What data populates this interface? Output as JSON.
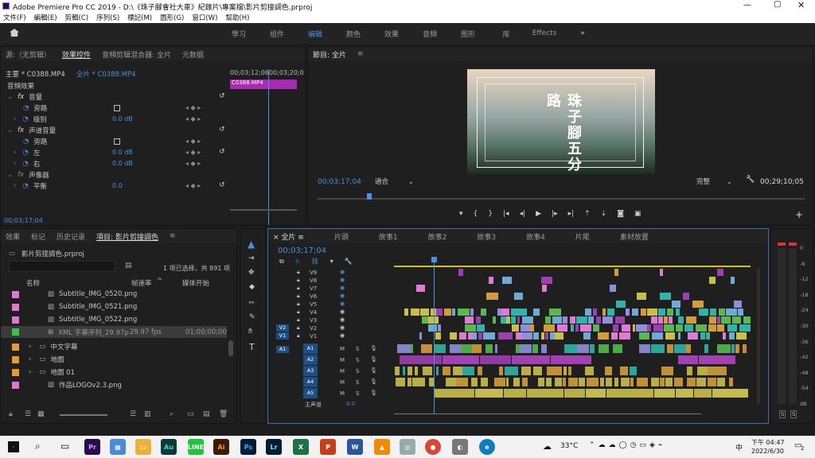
{
  "window": {
    "title": "Adobe Premiere Pro CC 2019 - D:\\《珠子腳會社大車》紀錄片\\專案檔\\影片剪接調色.prproj"
  },
  "menu": [
    "文件(F)",
    "編輯(E)",
    "剪輯(C)",
    "序列(S)",
    "標記(M)",
    "圖形(G)",
    "窗口(W)",
    "幫助(H)"
  ],
  "workspaces": {
    "tabs": [
      "學习",
      "组件",
      "编辑",
      "颜色",
      "效果",
      "音頻",
      "图形",
      "库",
      "Effects"
    ],
    "active": "编辑"
  },
  "effect_controls": {
    "tabs": [
      "源:（无剪辑）",
      "效果控件",
      "音頻剪辑混合器: 全片",
      "元数据"
    ],
    "source_label": "主要 * C0388.MP4",
    "seq_label": "全片 * C0388.MP4",
    "time1": "00;03;12;06",
    "time2": "00;03;20;0",
    "clip_name": "C0388.MP4",
    "section": "音頻效果",
    "rows": [
      {
        "label": "音量",
        "val": ""
      },
      {
        "label": "旁路",
        "val": ""
      },
      {
        "label": "级别",
        "val": "0.0 dB"
      },
      {
        "label": "声道音量",
        "val": ""
      },
      {
        "label": "旁路",
        "val": ""
      },
      {
        "label": "左",
        "val": "0.0 dB"
      },
      {
        "label": "右",
        "val": "0.0 dB"
      },
      {
        "label": "声像器",
        "val": ""
      },
      {
        "label": "平衡",
        "val": "0.0"
      }
    ],
    "timecode": "00;03;17;04"
  },
  "program": {
    "title": "節目: 全片",
    "poster_title": "珠子腳五分路",
    "timecode": "00;03;17;04",
    "fit": "適合",
    "quality": "完整",
    "duration": "00;29;10;05"
  },
  "project": {
    "tabs": [
      "效果",
      "标记",
      "历史记录",
      "項目: 影片剪接調色"
    ],
    "file": "影片剪接調色.prproj",
    "selection": "1 项已选择，共 891 项",
    "col_name": "名称",
    "col_rate": "帧速率",
    "col_start": "媒体开始",
    "items": [
      {
        "name": "Subtitle_IMG_0520.png",
        "rate": "",
        "start": ""
      },
      {
        "name": "Subtitle_IMG_0521.png",
        "rate": "",
        "start": ""
      },
      {
        "name": "Subtitle_IMG_0522.png",
        "rate": "",
        "start": ""
      },
      {
        "name": "XML 字幕序列_29.97p",
        "rate": "29.97 fps",
        "start": "01;00;00;00"
      },
      {
        "name": "中文字幕",
        "rate": "",
        "start": ""
      },
      {
        "name": "地圖",
        "rate": "",
        "start": ""
      },
      {
        "name": "地圖 01",
        "rate": "",
        "start": ""
      },
      {
        "name": "作品LOGOv2.3.png",
        "rate": "",
        "start": ""
      }
    ]
  },
  "timeline": {
    "tabs": [
      "全片",
      "片頭",
      "故事1",
      "故事2",
      "故事3",
      "故事4",
      "片尾",
      "素材放置"
    ],
    "timecode": "00;03;17;04",
    "video_tracks": [
      "V9",
      "V8",
      "V7",
      "V6",
      "V5",
      "V4",
      "V3",
      "V2",
      "V1"
    ],
    "audio_tracks": [
      "A1",
      "A2",
      "A3",
      "A4",
      "A5"
    ],
    "master": "主声道",
    "master_val": "0.0"
  },
  "meter": {
    "ticks": [
      "0",
      "-6",
      "-12",
      "-18",
      "-24",
      "-30",
      "-36",
      "-42",
      "-48",
      "-54",
      "dB"
    ]
  },
  "taskbar": {
    "temp": "33°C",
    "ime": "中",
    "time": "下午 04:47",
    "date": "2022/6/30",
    "badge": "2"
  },
  "colors": {
    "accent": "#4a90e2",
    "playhead": "#4a90e2",
    "clip_purple": "#9c3fb3",
    "clip_yellow": "#c9c04a"
  }
}
